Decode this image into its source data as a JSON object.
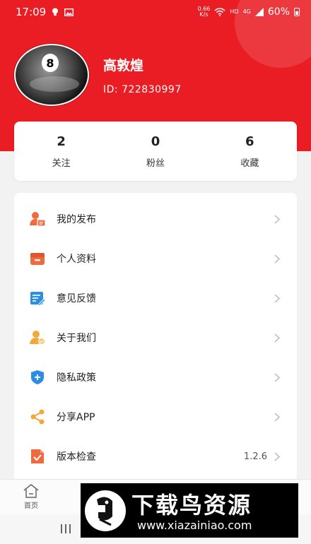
{
  "status_bar": {
    "time": "17:09",
    "net_speed_value": "0.66",
    "net_speed_unit": "K/s",
    "hd_label": "HD",
    "signal_label": "4G",
    "battery": "60%"
  },
  "profile": {
    "name": "高敦煌",
    "id_text": "ID: 722830997"
  },
  "stats": [
    {
      "value": "2",
      "label": "关注"
    },
    {
      "value": "0",
      "label": "粉丝"
    },
    {
      "value": "6",
      "label": "收藏"
    }
  ],
  "menu": {
    "items": [
      {
        "label": "我的发布",
        "icon": "user-post-icon"
      },
      {
        "label": "个人资料",
        "icon": "profile-box-icon"
      },
      {
        "label": "意见反馈",
        "icon": "feedback-icon"
      },
      {
        "label": "关于我们",
        "icon": "about-user-icon"
      },
      {
        "label": "隐私政策",
        "icon": "shield-icon"
      },
      {
        "label": "分享APP",
        "icon": "share-icon"
      },
      {
        "label": "版本检查",
        "icon": "version-doc-icon",
        "value": "1.2.6"
      }
    ]
  },
  "tabbar": {
    "home_label": "首页"
  },
  "watermark": {
    "title": "下载鸟资源",
    "url": "www.xiazainiao.com"
  },
  "colors": {
    "brand_red": "#ea1c24",
    "icon_orange": "#ef6a3f",
    "icon_blue": "#2b8de3",
    "icon_yellow": "#f2a83a"
  }
}
